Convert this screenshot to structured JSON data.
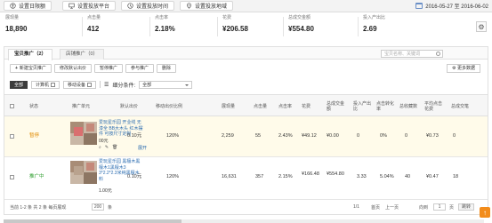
{
  "toolbar": {
    "btn_daily_limit": "设置日限额",
    "btn_platform": "设置投放平台",
    "btn_time": "设置投放时间",
    "btn_region": "设置投放地域",
    "date_range": "2016-05-27 至 2016-06-02"
  },
  "stats": [
    {
      "label": "展现量",
      "value": "18,890"
    },
    {
      "label": "点击量",
      "value": "412"
    },
    {
      "label": "点击率",
      "value": "2.18%"
    },
    {
      "label": "花费",
      "value": "¥206.58"
    },
    {
      "label": "总成交金额",
      "value": "¥554.80"
    },
    {
      "label": "投入产出比",
      "value": "2.69"
    }
  ],
  "tabs": [
    {
      "label": "宝贝推广（2）"
    },
    {
      "label": "店铺推广（0）"
    }
  ],
  "search": {
    "placeholder": "宝贝名称、关键词"
  },
  "actions": {
    "new": "新建宝贝推广",
    "modify_price": "修改默认出价",
    "pause": "暂停推广",
    "join": "参与推广",
    "delete": "删除",
    "more_data": "更多数据"
  },
  "filters": {
    "all": "全部",
    "plan": "计算机",
    "mobile": "移动设备",
    "cond_label": "细分条件:",
    "cond_value": "全部"
  },
  "table": {
    "headers": [
      "状态",
      "推广单元",
      "默认出价",
      "移动出价比例",
      "展现量",
      "点击量",
      "点击率",
      "花费",
      "总成交金额",
      "投入产出比",
      "点击转化率",
      "总收藏数",
      "平均点击花费",
      "总成交笔"
    ],
    "rows": [
      {
        "status": "暂停",
        "title": "爱玩星乐园 开业线 无漆全 BB大木头 红木摆件 可按尺寸定制",
        "price_label": "00元",
        "expand": "展开",
        "bid": "0.10元",
        "mobile_ratio": "120%",
        "impressions": "2,259",
        "clicks": "55",
        "ctr": "2.43%",
        "cost": "¥49.12",
        "total_sales": "¥0.00",
        "roi": "0",
        "cvr": "0%",
        "favorites": "0",
        "avg_cpc": "¥0.73",
        "orders": "0"
      },
      {
        "status": "推广中",
        "title": "爱玩星乐园 黑檀木黑檀木1黑檀木3 3*2.2*2.3米纯黑檀木料",
        "price_label": "1.00元",
        "expand": "",
        "bid": "0.10元",
        "mobile_ratio": "120%",
        "impressions": "16,631",
        "clicks": "357",
        "ctr": "2.15%",
        "cost": "¥166.48",
        "total_sales": "¥554.80",
        "roi": "3.33",
        "cvr": "5.04%",
        "favorites": "40",
        "avg_cpc": "¥0.47",
        "orders": "18"
      }
    ]
  },
  "footer": {
    "summary": "当前 1-2 条  共 2 条  每页展现",
    "per_page": "200",
    "per_page_unit": "条",
    "page_info": "1/1",
    "first": "首页",
    "prev": "上一页",
    "goto_label": "向到",
    "page_input": "1",
    "page_unit": "页",
    "go": "跳转"
  }
}
